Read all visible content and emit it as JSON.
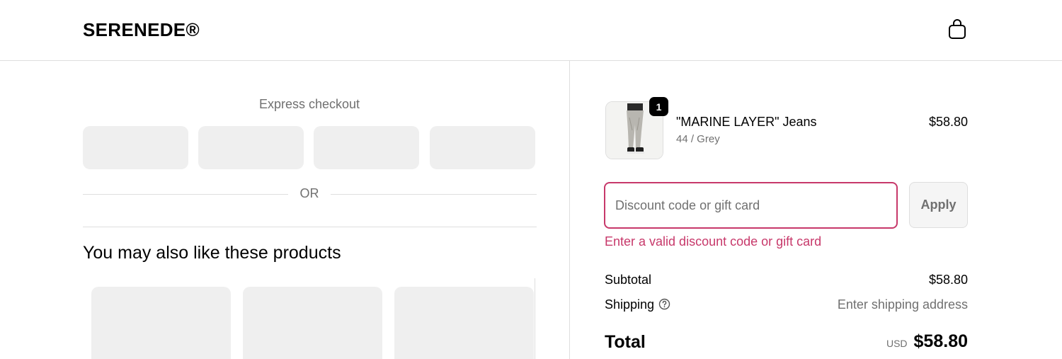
{
  "header": {
    "brand": "SERENEDE®",
    "cart_icon": "shopping-bag-icon"
  },
  "checkout": {
    "express_title": "Express checkout",
    "express_buttons": 4,
    "or_label": "OR",
    "recommendations_title": "You may also like these products",
    "recommendation_cards": 3
  },
  "order": {
    "item": {
      "name": "\"MARINE LAYER\" Jeans",
      "variant": "44 / Grey",
      "price": "$58.80",
      "quantity": "1"
    },
    "discount": {
      "placeholder": "Discount code or gift card",
      "apply_label": "Apply",
      "error": "Enter a valid discount code or gift card"
    },
    "subtotal_label": "Subtotal",
    "subtotal_value": "$58.80",
    "shipping_label": "Shipping",
    "shipping_value": "Enter shipping address",
    "total_label": "Total",
    "currency": "USD",
    "total_value": "$58.80"
  },
  "colors": {
    "error": "#c7386a",
    "muted": "#707070",
    "placeholder_block": "#efefef",
    "border": "#dedede"
  }
}
